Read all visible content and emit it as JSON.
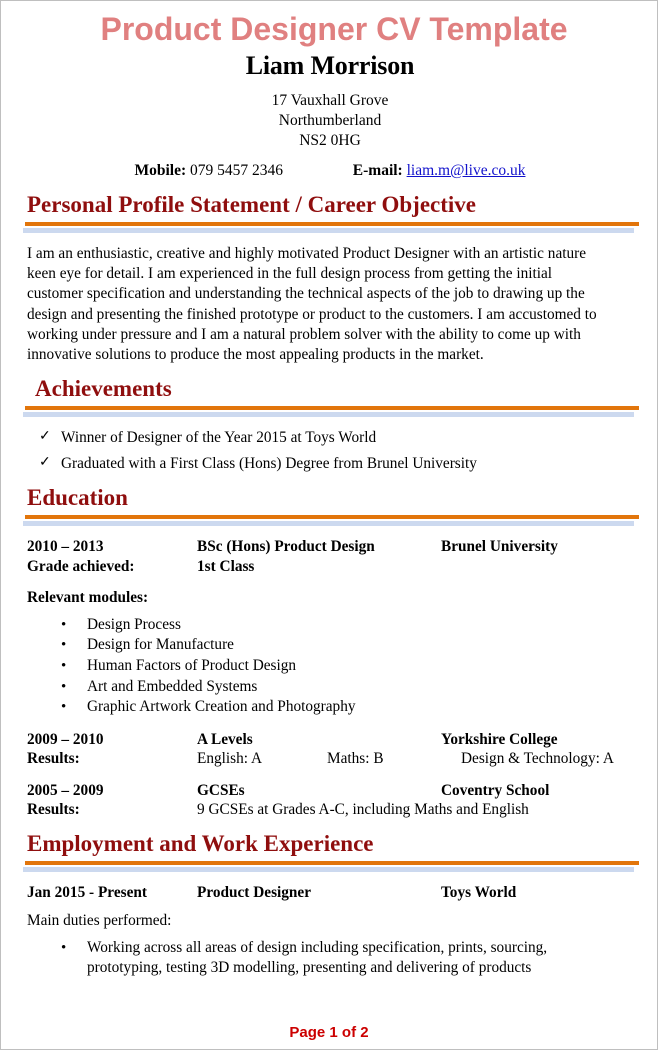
{
  "document": {
    "title": "Product Designer CV Template",
    "name": "Liam Morrison",
    "footer": "Page 1 of 2"
  },
  "colors": {
    "title": "#e08080",
    "heading": "#8f0e0e",
    "rule_orange": "#e2750b",
    "rule_blue": "#ccd9ef",
    "link": "#1111cc",
    "footer": "#cc0000"
  },
  "contact": {
    "address_line1": "17 Vauxhall Grove",
    "address_line2": "Northumberland",
    "address_line3": "NS2 0HG",
    "mobile_label": "Mobile:",
    "mobile_value": "079 5457 2346",
    "email_label": "E-mail:",
    "email_value": "liam.m@live.co.uk"
  },
  "sections": {
    "profile": {
      "heading": "Personal Profile Statement / Career Objective",
      "paragraph": "I am an enthusiastic, creative and highly motivated Product Designer with an artistic nature keen eye for detail. I am experienced in the full design process from getting the initial customer specification and understanding the technical aspects of the job to drawing up the design and presenting the finished prototype or product to the customers. I am accustomed to working under pressure and I am a natural problem solver with the ability to come up with innovative solutions to produce the most appealing products in the market."
    },
    "achievements": {
      "heading": "Achievements",
      "bullet_glyph": "✓",
      "items": [
        "Winner of Designer of the Year 2015 at Toys World",
        "Graduated with a First Class (Hons) Degree from Brunel University"
      ]
    },
    "education": {
      "heading": "Education",
      "entries": [
        {
          "dates": "2010 – 2013",
          "qualification": "BSc (Hons) Product Design",
          "institution": "Brunel University",
          "detail_label": "Grade achieved:",
          "detail_value": "1st Class",
          "detail_bold": true
        }
      ],
      "modules_label": "Relevant modules:",
      "bullet_glyph": "•",
      "modules": [
        "Design Process",
        "Design for Manufacture",
        "Human Factors of Product Design",
        "Art and Embedded Systems",
        "Graphic Artwork Creation and Photography"
      ],
      "alevels": {
        "dates": "2009 – 2010",
        "qualification": "A Levels",
        "institution": "Yorkshire College",
        "results_label": "Results:",
        "result1": "English: A",
        "result2": "Maths: B",
        "result3": "Design & Technology:  A"
      },
      "gcses": {
        "dates": "2005 – 2009",
        "qualification": "GCSEs",
        "institution": "Coventry School",
        "results_label": "Results:",
        "results_value": "9 GCSEs at Grades A-C, including Maths and English"
      }
    },
    "employment": {
      "heading": "Employment and Work Experience",
      "dates": "Jan 2015 - Present",
      "job_title": "Product Designer",
      "employer": "Toys World",
      "duties_label": "Main duties performed:",
      "bullet_glyph": "•",
      "duties": [
        "Working across all areas of design including specification, prints, sourcing, prototyping, testing 3D modelling, presenting and delivering of products"
      ]
    }
  }
}
